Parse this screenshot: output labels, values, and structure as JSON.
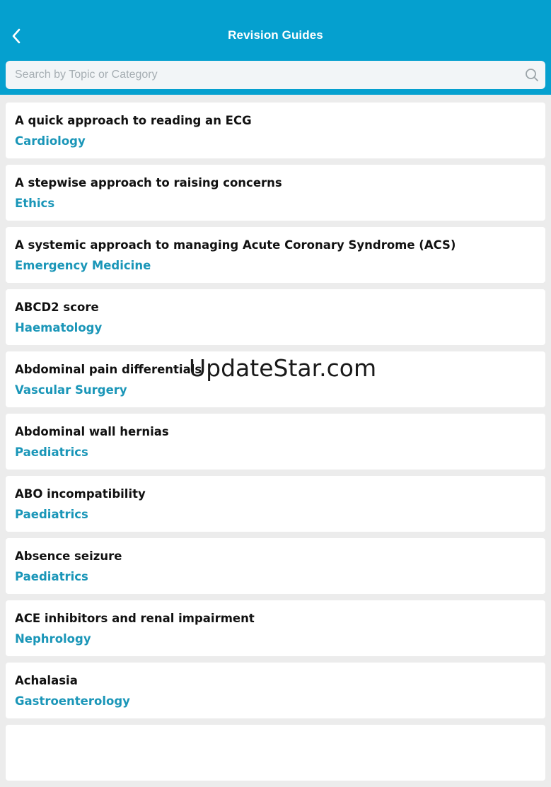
{
  "header": {
    "title": "Revision Guides",
    "background_color": "#05a0cf",
    "back_icon": "chevron-left-icon"
  },
  "search": {
    "placeholder": "Search by Topic or Category",
    "value": "",
    "icon": "search-icon"
  },
  "guides": [
    {
      "topic": "A quick approach to reading an ECG",
      "category": "Cardiology"
    },
    {
      "topic": "A stepwise approach to raising concerns",
      "category": "Ethics"
    },
    {
      "topic": "A systemic approach to managing Acute Coronary Syndrome (ACS)",
      "category": "Emergency Medicine"
    },
    {
      "topic": "ABCD2 score",
      "category": "Haematology"
    },
    {
      "topic": "Abdominal pain differentials",
      "category": "Vascular Surgery"
    },
    {
      "topic": "Abdominal wall hernias",
      "category": "Paediatrics"
    },
    {
      "topic": "ABO incompatibility",
      "category": "Paediatrics"
    },
    {
      "topic": "Absence seizure",
      "category": "Paediatrics"
    },
    {
      "topic": "ACE inhibitors and renal impairment",
      "category": "Nephrology"
    },
    {
      "topic": "Achalasia",
      "category": "Gastroenterology"
    },
    {
      "topic": "",
      "category": ""
    }
  ],
  "category_color": "#1a96b8",
  "watermark": "UpdateStar.com"
}
